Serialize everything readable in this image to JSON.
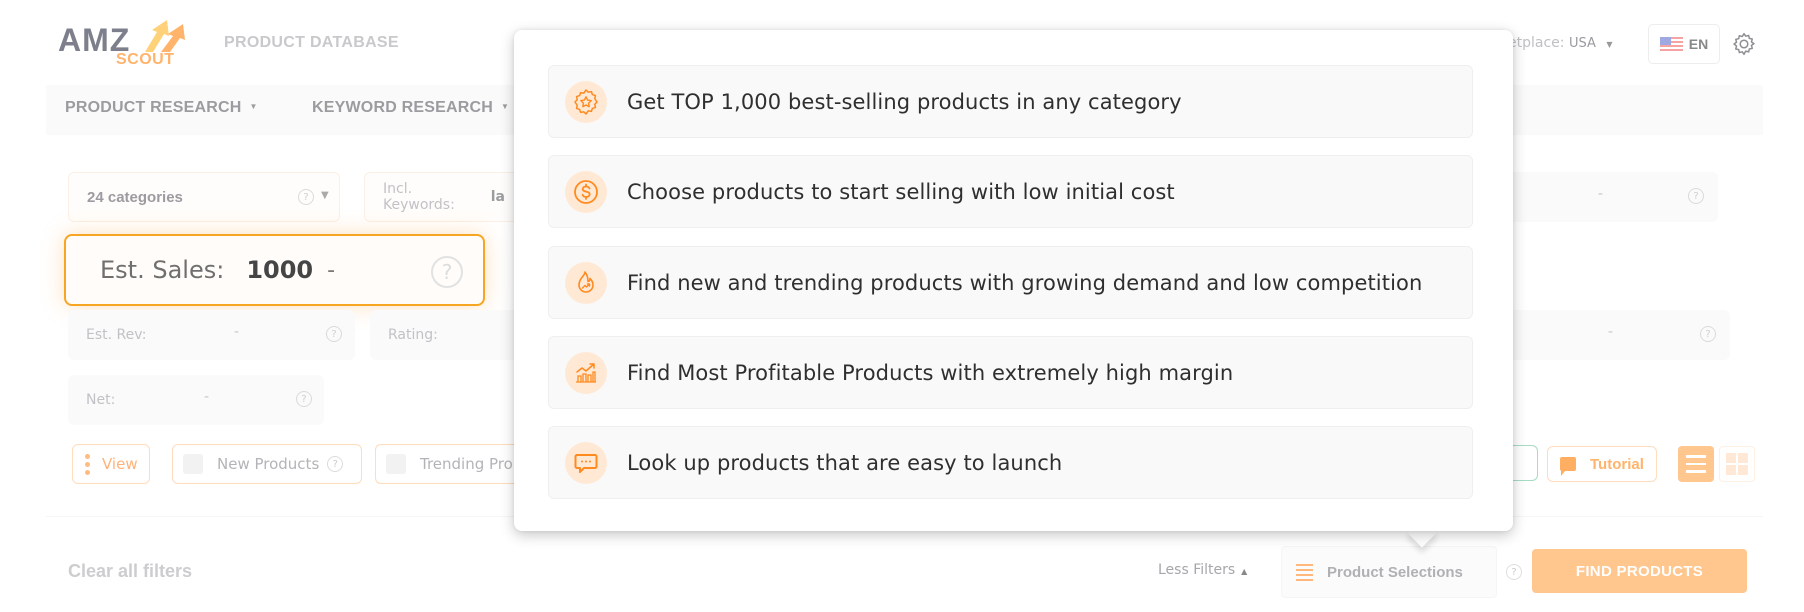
{
  "header": {
    "logo_top": "AMZ",
    "logo_bottom": "SCOUT",
    "app_title": "PRODUCT DATABASE",
    "marketplace_label": "etplace:",
    "marketplace_value": "USA",
    "language": "EN"
  },
  "nav": {
    "items": [
      {
        "label": "PRODUCT RESEARCH"
      },
      {
        "label": "KEYWORD RESEARCH"
      }
    ]
  },
  "filters": {
    "categories": "24  categories",
    "incl_keywords_label": "Incl. Keywords:",
    "incl_keywords_value": "la",
    "est_sales_label": "Est. Sales:",
    "est_sales_min": "1000",
    "est_sales_sep": "-",
    "est_rev_label": "Est. Rev:",
    "est_rev_value": "-",
    "rating_label": "Rating:",
    "net_label": "Net:",
    "net_value": "-",
    "right_top_value": "-",
    "right_mid_label": "/:",
    "right_mid_value": "-",
    "help": "?"
  },
  "toolbar": {
    "view_label": "View",
    "new_products_label": "New Products",
    "trending_label": "Trending Pro",
    "tutorial_label": "Tutorial"
  },
  "footer": {
    "clear_filters": "Clear all filters",
    "less_filters": "Less Filters",
    "product_selections": "Product Selections",
    "find_products": "FIND PRODUCTS"
  },
  "popup": {
    "items": [
      {
        "icon": "star-badge-icon",
        "text": "Get TOP 1,000 best-selling products in any category"
      },
      {
        "icon": "dollar-coin-icon",
        "text": "Choose products to start selling with low initial cost"
      },
      {
        "icon": "flame-trend-icon",
        "text": "Find new and trending products with growing demand and low competition"
      },
      {
        "icon": "growth-chart-icon",
        "text": "Find Most Profitable Products with extremely high margin"
      },
      {
        "icon": "chat-bubble-icon",
        "text": "Look up products that are easy to launch"
      }
    ]
  },
  "colors": {
    "accent": "#f6a623",
    "icon_orange": "#ff8a1f",
    "icon_bg": "#ffe9d5",
    "find_button": "#ffc78e"
  }
}
